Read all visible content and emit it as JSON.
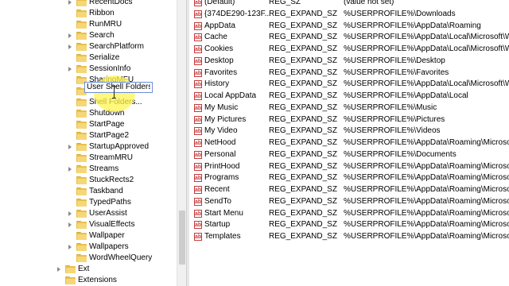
{
  "tree": {
    "items": [
      {
        "label": "RecentDocs",
        "indent": 2,
        "expander": true
      },
      {
        "label": "Ribbon",
        "indent": 2,
        "expander": false
      },
      {
        "label": "RunMRU",
        "indent": 2,
        "expander": false
      },
      {
        "label": "Search",
        "indent": 2,
        "expander": true
      },
      {
        "label": "SearchPlatform",
        "indent": 2,
        "expander": true
      },
      {
        "label": "Serialize",
        "indent": 2,
        "expander": false
      },
      {
        "label": "SessionInfo",
        "indent": 2,
        "expander": true
      },
      {
        "label": "SharingMFU",
        "indent": 2,
        "expander": false
      },
      {
        "label": "",
        "indent": 2,
        "expander": false,
        "editing": true
      },
      {
        "label": "Shell Folders...",
        "indent": 2,
        "expander": false
      },
      {
        "label": "Shutdown",
        "indent": 2,
        "expander": false
      },
      {
        "label": "StartPage",
        "indent": 2,
        "expander": false
      },
      {
        "label": "StartPage2",
        "indent": 2,
        "expander": false
      },
      {
        "label": "StartupApproved",
        "indent": 2,
        "expander": true
      },
      {
        "label": "StreamMRU",
        "indent": 2,
        "expander": false
      },
      {
        "label": "Streams",
        "indent": 2,
        "expander": true
      },
      {
        "label": "StuckRects2",
        "indent": 2,
        "expander": false
      },
      {
        "label": "Taskband",
        "indent": 2,
        "expander": false
      },
      {
        "label": "TypedPaths",
        "indent": 2,
        "expander": false
      },
      {
        "label": "UserAssist",
        "indent": 2,
        "expander": true
      },
      {
        "label": "VisualEffects",
        "indent": 2,
        "expander": true
      },
      {
        "label": "Wallpaper",
        "indent": 2,
        "expander": false
      },
      {
        "label": "Wallpapers",
        "indent": 2,
        "expander": true
      },
      {
        "label": "WordWheelQuery",
        "indent": 2,
        "expander": false
      },
      {
        "label": "Ext",
        "indent": 1,
        "expander": true
      },
      {
        "label": "Extensions",
        "indent": 1,
        "expander": false
      }
    ],
    "rename_value": "User Shell Folders"
  },
  "values": {
    "rows": [
      {
        "name": "(Default)",
        "type": "REG_SZ",
        "data": "(value not set)"
      },
      {
        "name": "{374DE290-123F...",
        "type": "REG_EXPAND_SZ",
        "data": "%USERPROFILE%\\Downloads"
      },
      {
        "name": "AppData",
        "type": "REG_EXPAND_SZ",
        "data": "%USERPROFILE%\\AppData\\Roaming"
      },
      {
        "name": "Cache",
        "type": "REG_EXPAND_SZ",
        "data": "%USERPROFILE%\\AppData\\Local\\Microsoft\\Wind"
      },
      {
        "name": "Cookies",
        "type": "REG_EXPAND_SZ",
        "data": "%USERPROFILE%\\AppData\\Local\\Microsoft\\Wind"
      },
      {
        "name": "Desktop",
        "type": "REG_EXPAND_SZ",
        "data": "%USERPROFILE%\\Desktop"
      },
      {
        "name": "Favorites",
        "type": "REG_EXPAND_SZ",
        "data": "%USERPROFILE%\\Favorites"
      },
      {
        "name": "History",
        "type": "REG_EXPAND_SZ",
        "data": "%USERPROFILE%\\AppData\\Local\\Microsoft\\Wind"
      },
      {
        "name": "Local AppData",
        "type": "REG_EXPAND_SZ",
        "data": "%USERPROFILE%\\AppData\\Local"
      },
      {
        "name": "My Music",
        "type": "REG_EXPAND_SZ",
        "data": "%USERPROFILE%\\Music"
      },
      {
        "name": "My Pictures",
        "type": "REG_EXPAND_SZ",
        "data": "%USERPROFILE%\\Pictures"
      },
      {
        "name": "My Video",
        "type": "REG_EXPAND_SZ",
        "data": "%USERPROFILE%\\Videos"
      },
      {
        "name": "NetHood",
        "type": "REG_EXPAND_SZ",
        "data": "%USERPROFILE%\\AppData\\Roaming\\Microsoft\\W"
      },
      {
        "name": "Personal",
        "type": "REG_EXPAND_SZ",
        "data": "%USERPROFILE%\\Documents"
      },
      {
        "name": "PrintHood",
        "type": "REG_EXPAND_SZ",
        "data": "%USERPROFILE%\\AppData\\Roaming\\Microsoft\\W"
      },
      {
        "name": "Programs",
        "type": "REG_EXPAND_SZ",
        "data": "%USERPROFILE%\\AppData\\Roaming\\Microsoft\\W"
      },
      {
        "name": "Recent",
        "type": "REG_EXPAND_SZ",
        "data": "%USERPROFILE%\\AppData\\Roaming\\Microsoft\\W"
      },
      {
        "name": "SendTo",
        "type": "REG_EXPAND_SZ",
        "data": "%USERPROFILE%\\AppData\\Roaming\\Microsoft\\W"
      },
      {
        "name": "Start Menu",
        "type": "REG_EXPAND_SZ",
        "data": "%USERPROFILE%\\AppData\\Roaming\\Microsoft\\W"
      },
      {
        "name": "Startup",
        "type": "REG_EXPAND_SZ",
        "data": "%USERPROFILE%\\AppData\\Roaming\\Microsoft\\W"
      },
      {
        "name": "Templates",
        "type": "REG_EXPAND_SZ",
        "data": "%USERPROFILE%\\AppData\\Roaming\\Microsoft\\W"
      }
    ]
  },
  "colors": {
    "folder": "#f6d778",
    "value_icon": "#c43c3c",
    "rename_border": "#6b8fd6",
    "highlight": "#fff550"
  }
}
